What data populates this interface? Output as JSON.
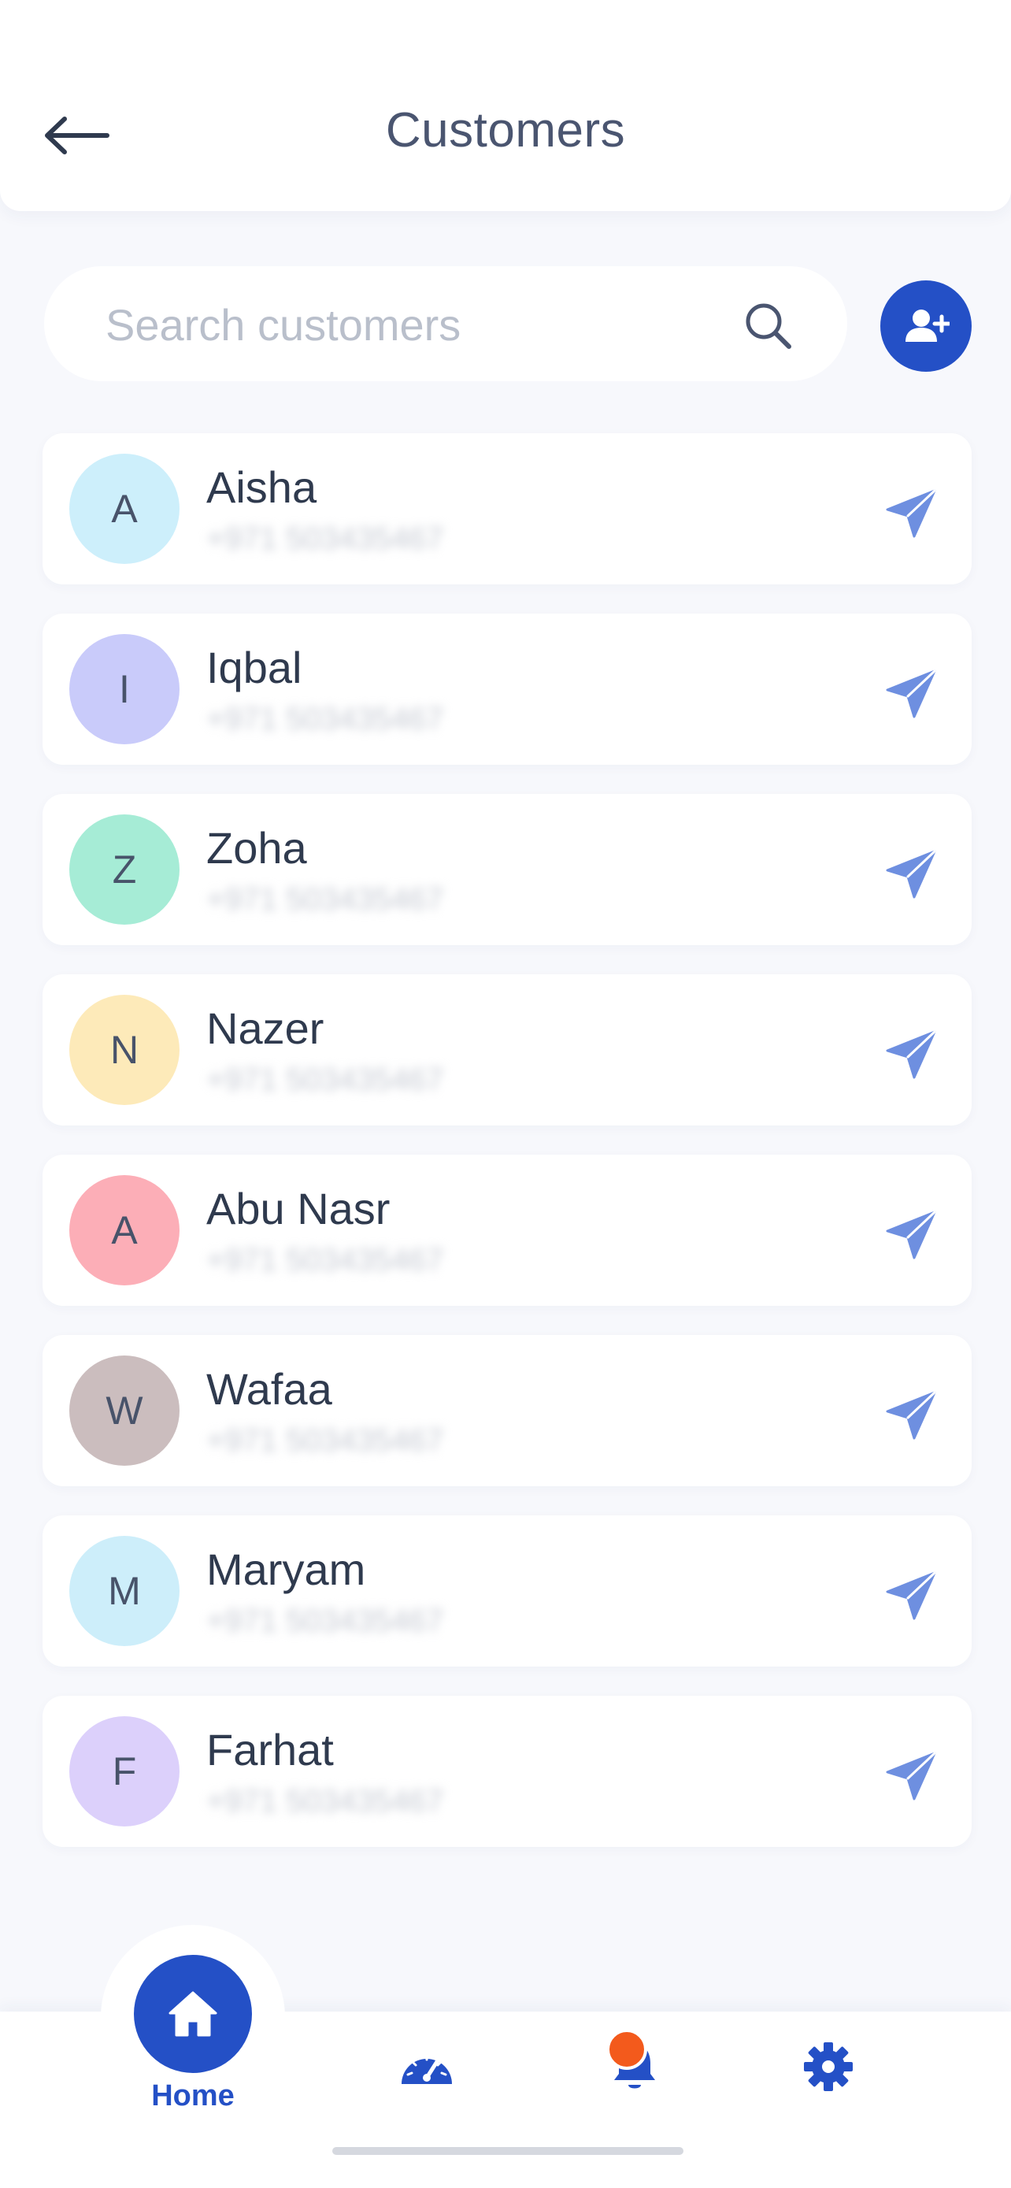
{
  "header": {
    "title": "Customers",
    "back_icon": "arrow-left-icon"
  },
  "search": {
    "placeholder": "Search customers",
    "value": "",
    "icon": "search-icon"
  },
  "add_button": {
    "icon": "user-plus-icon",
    "color": "#2450c6"
  },
  "customers": [
    {
      "initial": "A",
      "name": "Aisha",
      "phone": "+971 503435467",
      "avatar_color": "#cdeffb"
    },
    {
      "initial": "I",
      "name": "Iqbal",
      "phone": "+971 503435467",
      "avatar_color": "#c9cbfa"
    },
    {
      "initial": "Z",
      "name": "Zoha",
      "phone": "+971 503435467",
      "avatar_color": "#a6ecd6"
    },
    {
      "initial": "N",
      "name": "Nazer",
      "phone": "+971 503435467",
      "avatar_color": "#fdeab9"
    },
    {
      "initial": "A",
      "name": "Abu Nasr",
      "phone": "+971 503435467",
      "avatar_color": "#fcaeb7"
    },
    {
      "initial": "W",
      "name": "Wafaa",
      "phone": "+971 503435467",
      "avatar_color": "#cbbdbe"
    },
    {
      "initial": "M",
      "name": "Maryam",
      "phone": "+971 503435467",
      "avatar_color": "#cdeefa"
    },
    {
      "initial": "F",
      "name": "Farhat",
      "phone": "+971 503435467",
      "avatar_color": "#dcd0fb"
    }
  ],
  "send_icon": "send-icon",
  "tabs": {
    "home_label": "Home",
    "home_icon": "home-icon",
    "dashboard_icon": "speedometer-icon",
    "notifications_icon": "bell-icon",
    "settings_icon": "gear-icon"
  },
  "colors": {
    "accent": "#2450c6",
    "badge": "#f35a1c",
    "send": "#6e8fe0"
  }
}
